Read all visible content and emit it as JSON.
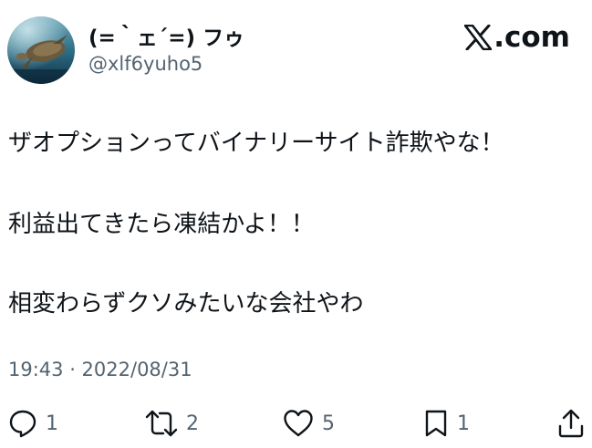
{
  "header": {
    "display_name": "(=｀ェ´=) フゥ",
    "handle": "@xlf6yuho5",
    "brand_text": ".com"
  },
  "tweet": {
    "lines": [
      "ザオプションってバイナリーサイト詐欺やな！",
      "利益出てきたら凍結かよ！！",
      "相変わらずクソみたいな会社やわ"
    ],
    "timestamp": "19:43 · 2022/08/31"
  },
  "actions": {
    "reply_count": "1",
    "retweet_count": "2",
    "like_count": "5",
    "bookmark_count": "1"
  },
  "icons": {
    "brand": "x-logo-icon",
    "reply": "reply-icon",
    "retweet": "retweet-icon",
    "like": "heart-icon",
    "bookmark": "bookmark-icon",
    "share": "share-icon"
  },
  "colors": {
    "text": "#0f1419",
    "secondary": "#536471",
    "background": "#ffffff"
  }
}
